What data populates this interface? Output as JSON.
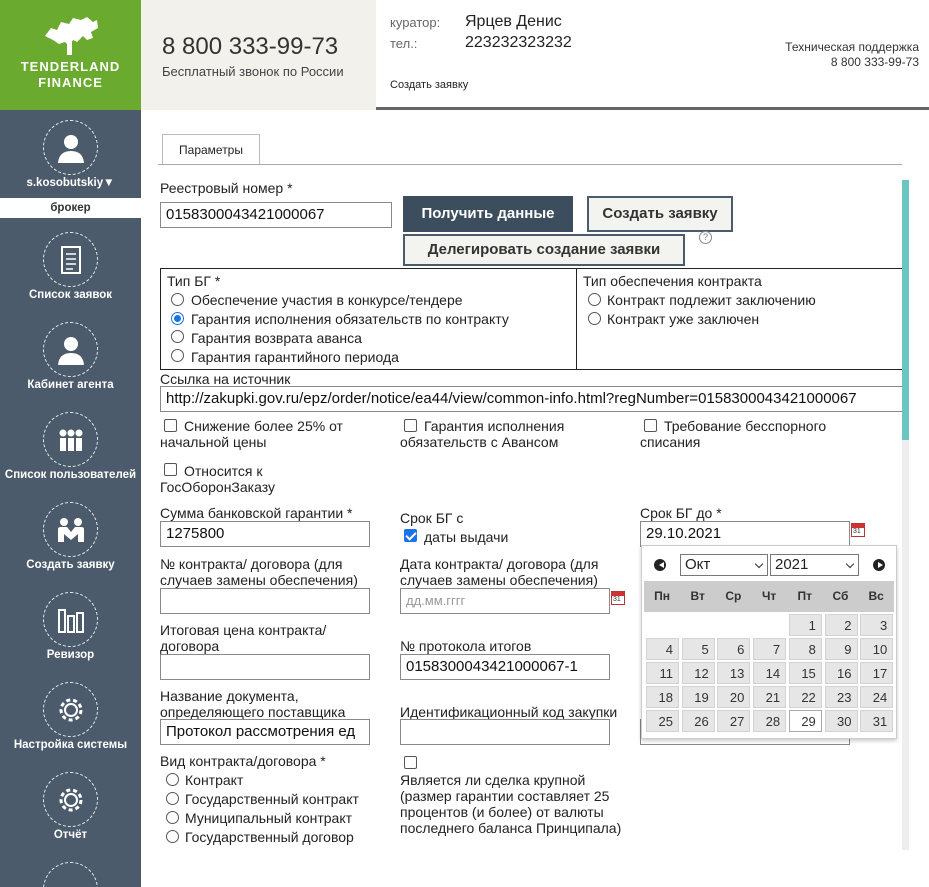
{
  "header": {
    "logo_line1": "TENDERLAND",
    "logo_line2": "FINANCE",
    "phone": "8 800 333-99-73",
    "phone_sub": "Бесплатный звонок по России",
    "curator_label": "куратор:",
    "curator_name": "Ярцев Денис",
    "tel_label": "тел.:",
    "tel_value": "223232323232",
    "create_link": "Создать заявку",
    "support_title": "Техническая поддержка",
    "support_phone": "8 800 333-99-73"
  },
  "sidebar": {
    "user": "s.kosobutskiy▼",
    "role": "брокер",
    "items": [
      {
        "label": "Список заявок",
        "icon": "document-list-icon"
      },
      {
        "label": "Кабинет агента",
        "icon": "agent-icon"
      },
      {
        "label": "Список пользователей",
        "icon": "users-icon"
      },
      {
        "label": "Создать заявку",
        "icon": "handshake-icon"
      },
      {
        "label": "Ревизор",
        "icon": "bar-chart-icon"
      },
      {
        "label": "Настройка системы",
        "icon": "gear-icon"
      },
      {
        "label": "Отчёт",
        "icon": "gear-icon"
      }
    ]
  },
  "tabs": {
    "params": "Параметры"
  },
  "form": {
    "registry_label": "Реестровый номер *",
    "registry_value": "0158300043421000067",
    "get_data": "Получить данные",
    "create_request": "Создать заявку",
    "delegate": "Делегировать создание заявки",
    "help": "?",
    "bg_type_label": "Тип БГ *",
    "bg_types": [
      {
        "label": "Обеспечение участия в конкурсе/тендере",
        "checked": false
      },
      {
        "label": "Гарантия исполнения обязательств по контракту",
        "checked": true
      },
      {
        "label": "Гарантия возврата аванса",
        "checked": false
      },
      {
        "label": "Гарантия гарантийного периода",
        "checked": false
      }
    ],
    "security_type_label": "Тип обеспечения контракта",
    "security_types": [
      {
        "label": "Контракт подлежит заключению",
        "checked": false
      },
      {
        "label": "Контракт уже заключен",
        "checked": false
      }
    ],
    "source_label": "Ссылка на источник",
    "source_value": "http://zakupki.gov.ru/epz/order/notice/ea44/view/common-info.html?regNumber=0158300043421000067",
    "cb_reduction": "Снижение более 25% от начальной цены",
    "cb_advance": "Гарантия исполнения обязательств с Авансом",
    "cb_indisputable": "Требование бесспорного списания",
    "cb_defense": "Относится к ГосОборонЗаказу",
    "amount_label": "Сумма банковской гарантии *",
    "amount_value": "1275800",
    "term_from_label": "Срок БГ с",
    "term_from_check": "даты выдачи",
    "term_to_label": "Срок БГ до *",
    "term_to_value": "29.10.2021",
    "contract_no_label": "№ контракта/ договора (для случаев замены обеспечения)",
    "contract_date_label": "Дата контракта/ договора (для случаев замены обеспечения)",
    "contract_date_placeholder": "дд.мм.гггг",
    "final_price_label": "Итоговая цена контракта/ договора",
    "protocol_label": "№ протокола итогов",
    "protocol_value": "0158300043421000067-1",
    "doc_name_label": "Название документа, определяющего поставщика",
    "doc_name_value": "Протокол рассмотрения ед",
    "purchase_id_label": "Идентификационный код закупки",
    "contract_kind_label": "Вид контракта/договора *",
    "contract_kinds": [
      "Контракт",
      "Государственный контракт",
      "Муниципальный контракт",
      "Государственный договор"
    ],
    "major_deal": "Является ли сделка крупной (размер гарантии составляет 25 процентов (и более) от валюты последнего баланса Принципала)"
  },
  "datepicker": {
    "month": "Окт",
    "year": "2021",
    "weekdays": [
      "Пн",
      "Вт",
      "Ср",
      "Чт",
      "Пт",
      "Сб",
      "Вс"
    ],
    "first_weekday_index": 4,
    "days_in_month": 31,
    "selected_day": 29
  }
}
